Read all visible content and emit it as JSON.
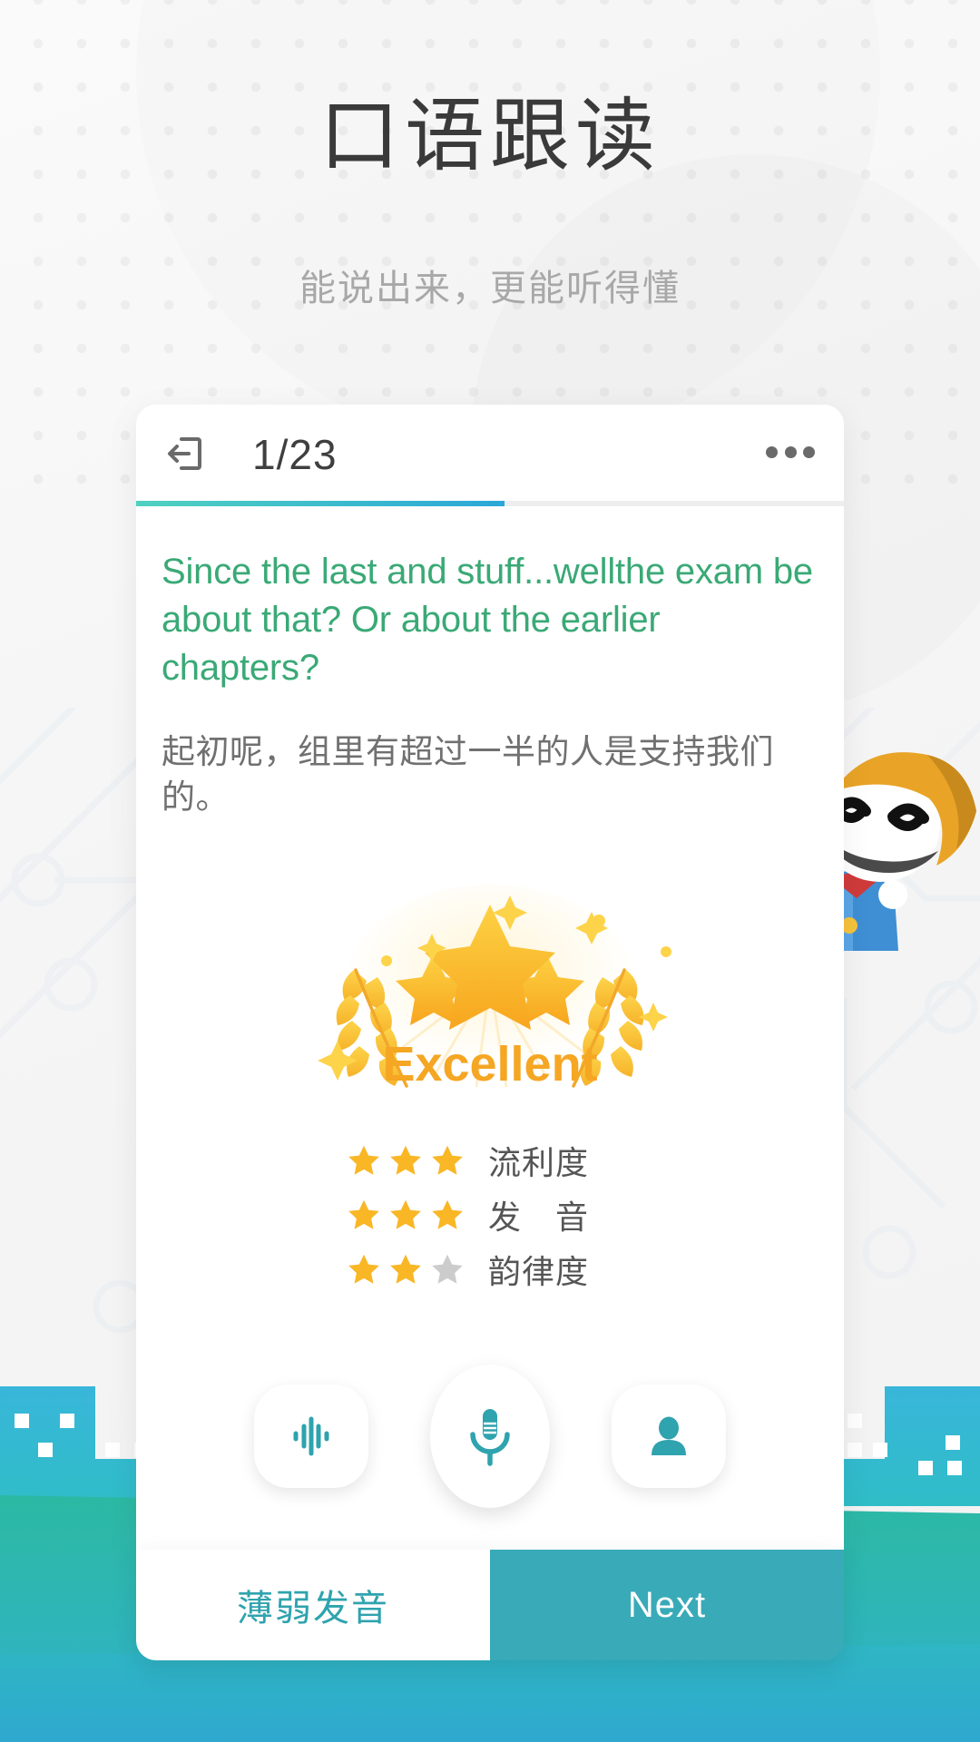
{
  "header": {
    "title": "口语跟读",
    "subtitle": "能说出来，更能听得懂"
  },
  "card": {
    "exit_icon": "exit-icon",
    "counter": "1/23",
    "more_icon": "more-options-icon",
    "progress_percent": 52,
    "sentence_en": "Since the last and stuff...wellthe exam be about that? Or about the earlier chapters?",
    "sentence_zh": "起初呢，组里有超过一半的人是支持我们的。"
  },
  "badge": {
    "label": "Excellent",
    "star_count": 3
  },
  "ratings": [
    {
      "label": "流利度",
      "filled": 3,
      "total": 3
    },
    {
      "label": "发　音",
      "filled": 3,
      "total": 3
    },
    {
      "label": "韵律度",
      "filled": 2,
      "total": 3
    }
  ],
  "controls": [
    {
      "name": "waveform-playback-button",
      "icon": "waveform-icon"
    },
    {
      "name": "record-microphone-button",
      "icon": "microphone-icon"
    },
    {
      "name": "native-speaker-button",
      "icon": "person-icon"
    }
  ],
  "footer": {
    "weak_label": "薄弱发音",
    "next_label": "Next"
  },
  "colors": {
    "accent_teal": "#39aab8",
    "sentence_green": "#3aa976",
    "star_gold": "#f9b726",
    "star_grey": "#cccccc",
    "progress_start": "#4fd1c0",
    "progress_end": "#2ba7d8",
    "skyline_blue": "#37b0dd",
    "ground_green": "#2bb79f",
    "title_grey": "#3a3a3a",
    "subtitle_grey": "#a8a8a8"
  }
}
